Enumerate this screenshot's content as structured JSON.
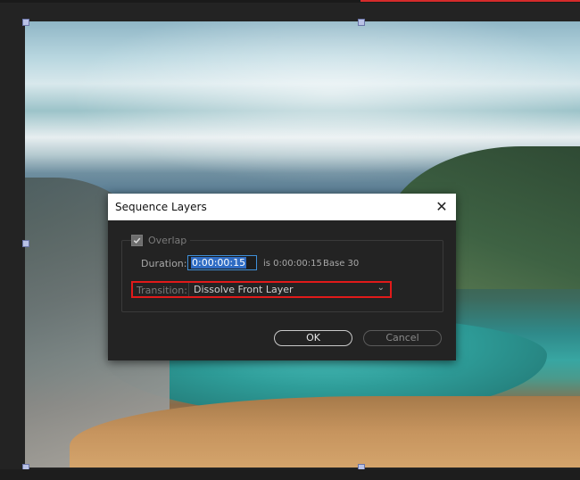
{
  "dialog": {
    "title": "Sequence Layers",
    "close_icon": "close-icon",
    "overlap": {
      "label": "Overlap",
      "checked": true
    },
    "duration": {
      "label": "Duration:",
      "value": "0:00:00:15",
      "is_text": "is 0:00:00:15",
      "base_text": "Base 30"
    },
    "transition": {
      "label": "Transition:",
      "value": "Dissolve Front Layer"
    },
    "buttons": {
      "ok": "OK",
      "cancel": "Cancel"
    }
  },
  "colors": {
    "highlight_border": "#e11a1a",
    "selection": "#2f6cc4",
    "background": "#232323"
  }
}
